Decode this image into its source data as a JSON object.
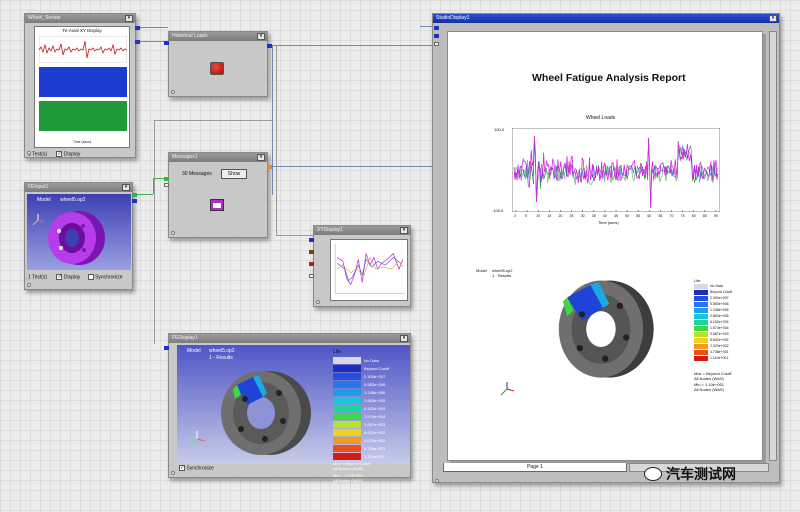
{
  "nodes": {
    "wheel_sensor": {
      "title": "Wheel_Sensor",
      "chart_title": "Tri-Axial XY Display",
      "x_caption": "Time (secs)",
      "count_label": "1 Test(s)",
      "display_label": "Display"
    },
    "historical_loads": {
      "title": "Historical Loads"
    },
    "fe_input": {
      "title": "FEInput1",
      "model_label": "Model",
      "model_value": "wheel5.op2",
      "count_label": "1 Test(s)",
      "display_label": "Display",
      "synchronize_label": "Synchronize"
    },
    "messages": {
      "title": "Messages1",
      "count_label": "30 Messages",
      "show_label": "Show"
    },
    "xy_display": {
      "title": "XYDisplay1"
    },
    "fe_display": {
      "title": "FEDisplay1",
      "model_label": "Model",
      "model_value": "wheel5.op2",
      "result_label": "1 - Results",
      "legend_title": "Life",
      "legend": [
        {
          "label": "No Data",
          "color": "#d9d9e6"
        },
        {
          "label": "Beyond Cutoff",
          "color": "#1f2dbd"
        },
        {
          "label": "2.300e+007",
          "color": "#2450e0"
        },
        {
          "label": "5.583e+006",
          "color": "#2a74f0"
        },
        {
          "label": "1.248e+006",
          "color": "#1a9fe8"
        },
        {
          "label": "2.863e+005",
          "color": "#19c6d8"
        },
        {
          "label": "6.152e+004",
          "color": "#1cd4a0"
        },
        {
          "label": "1.574e+004",
          "color": "#3fd64a"
        },
        {
          "label": "3.687e+003",
          "color": "#b6e22a"
        },
        {
          "label": "8.632e+002",
          "color": "#f0d21e"
        },
        {
          "label": "2.023e+002",
          "color": "#f29a1c"
        },
        {
          "label": "4.738e+001",
          "color": "#e8501c"
        },
        {
          "label": "1.110e+001",
          "color": "#d41a14"
        }
      ],
      "footer_line1": "Max = Beyond Cutoff",
      "footer_line2": "All Nodes (WAS)",
      "footer_line3": "Min = 1.10e+001",
      "footer_line4": "All Nodes (WAS)",
      "synchronize_label": "Synchronize"
    }
  },
  "studio": {
    "title": "StudioDisplay1",
    "report_title": "Wheel Fatigue Analysis Report",
    "chart_title": "Wheel Loads",
    "y_max_label": "100.0",
    "y_min_label": "-100.0",
    "x_ticks": [
      "0",
      "5",
      "10",
      "15",
      "20",
      "25",
      "30",
      "35",
      "40",
      "45",
      "50",
      "55",
      "60",
      "65",
      "70",
      "75",
      "80",
      "85",
      "90"
    ],
    "x_axis_label": "Time (secs)",
    "model_label": "Model",
    "model_value": "wheel5.op2",
    "result_label": "1 - Results",
    "min_note_1": "Min = 1.10e+001",
    "min_note_2": "All Nodes (WAS)",
    "max_note_1": "Max = Beyond Cutoff",
    "max_note_2": "All Nodes (WAS)",
    "legend_title": "Life",
    "legend_values": [
      "No Data",
      "Beyond Cutoff",
      "2.300e+007",
      "5.583e+006",
      "1.248e+006",
      "2.863e+005",
      "6.152e+004",
      "1.574e+004",
      "3.687e+003",
      "8.632e+002",
      "2.023e+002",
      "4.738e+001",
      "1.110e+001"
    ],
    "page_tab": "Page 1"
  },
  "watermark": "汽车测试网",
  "colors": {
    "fe_background_top": "#4f55c6",
    "fe_background_bottom": "#c6cbe9",
    "magenta_signal": "#d42be0",
    "node_title": "#7c7c7c",
    "studio_title": "#1a37c0"
  }
}
